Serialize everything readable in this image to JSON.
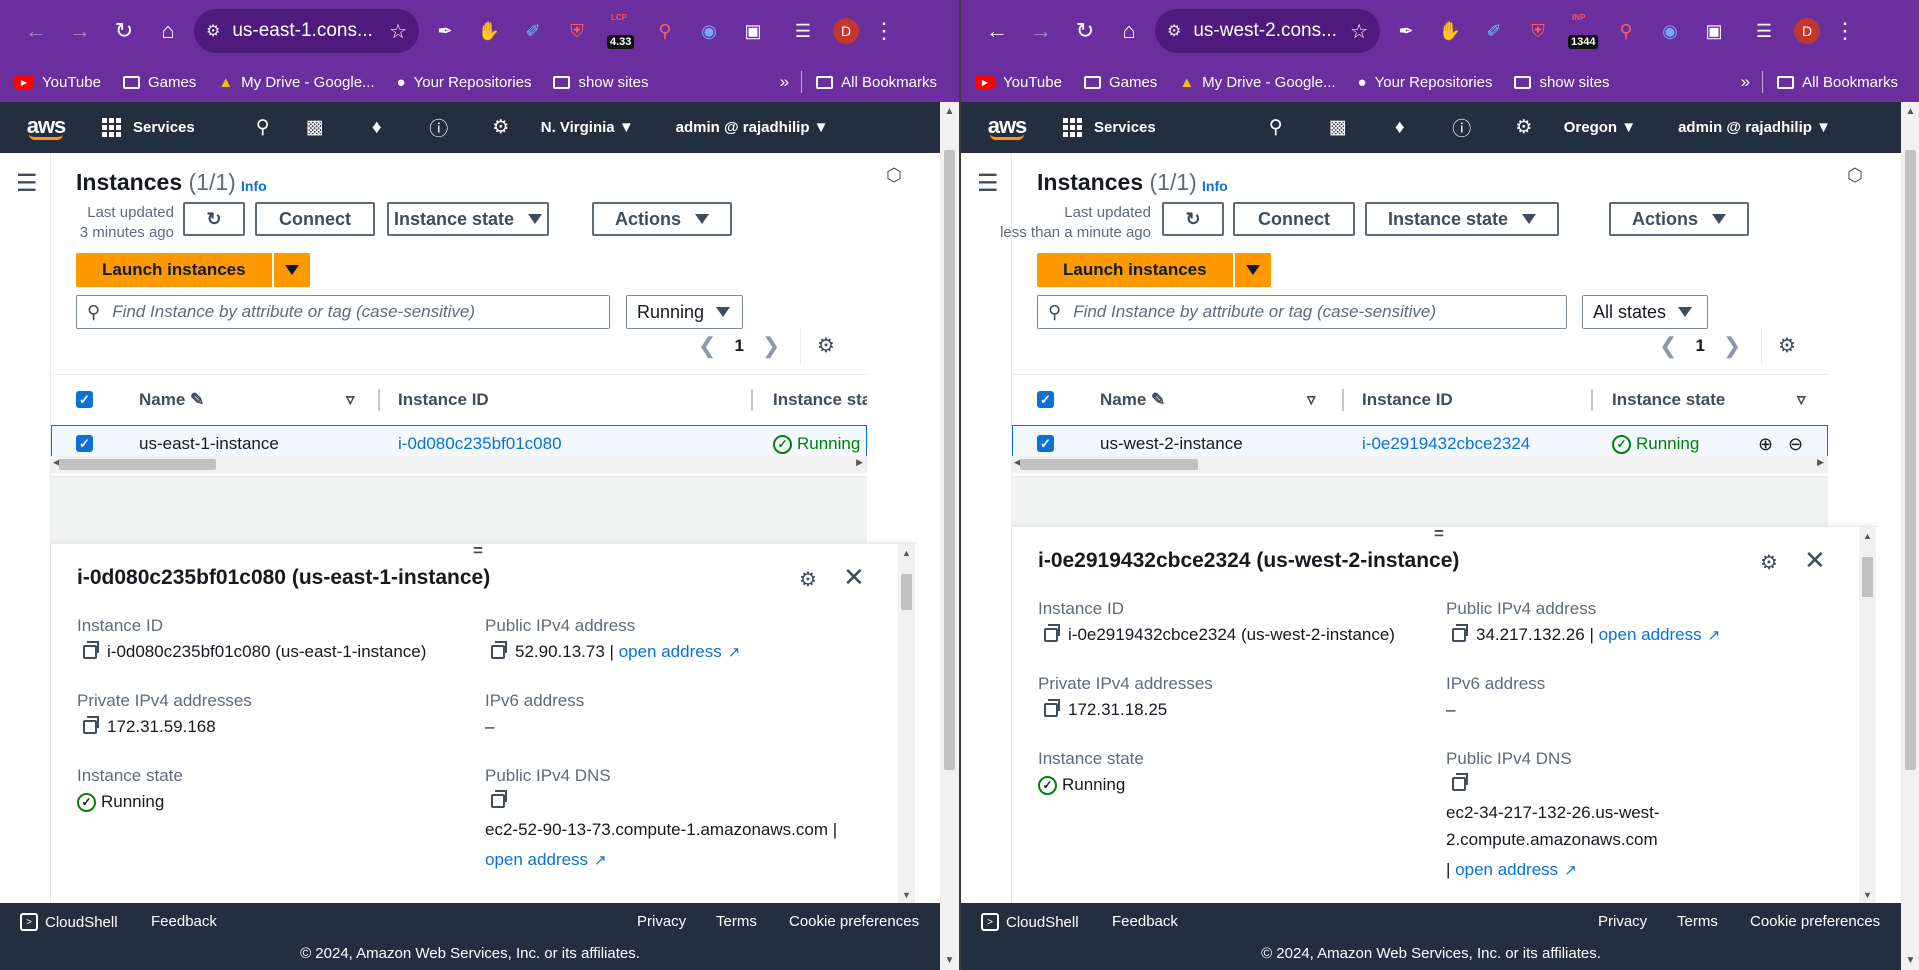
{
  "browser": {
    "bookmarks": [
      "YouTube",
      "Games",
      "My Drive - Google...",
      "Your Repositories",
      "show sites"
    ],
    "all_bookmarks": "All Bookmarks",
    "avatar_letter": "D"
  },
  "console": {
    "services_label": "Services",
    "account": "admin @ rajadhilip",
    "footer": {
      "cloudshell": "CloudShell",
      "feedback": "Feedback",
      "privacy": "Privacy",
      "terms": "Terms",
      "cookies": "Cookie preferences",
      "copyright": "© 2024, Amazon Web Services, Inc. or its affiliates."
    },
    "instances_title": "Instances",
    "info": "Info",
    "last_updated_label": "Last updated",
    "connect": "Connect",
    "instance_state_btn": "Instance state",
    "actions": "Actions",
    "launch": "Launch instances",
    "search_placeholder": "Find Instance by attribute or tag (case-sensitive)",
    "page_number": "1",
    "col_name": "Name",
    "col_instance_id": "Instance ID",
    "col_instance_state": "Instance state",
    "col_instance_state_trunc": "Instance sta",
    "detail_labels": {
      "instance_id": "Instance ID",
      "public_ipv4": "Public IPv4 address",
      "private_ipv4": "Private IPv4 addresses",
      "ipv6": "IPv6 address",
      "instance_state": "Instance state",
      "public_dns": "Public IPv4 DNS",
      "open_address": "open address"
    }
  },
  "left": {
    "url": "us-east-1.cons...",
    "ext_badge_top": "LCP",
    "ext_badge": "4.33",
    "region": "N. Virginia",
    "count": "(1/1)",
    "last_updated_value": "3 minutes ago",
    "filter_value": "Running",
    "row": {
      "name": "us-east-1-instance",
      "id": "i-0d080c235bf01c080",
      "state": "Running"
    },
    "detail": {
      "title": "i-0d080c235bf01c080 (us-east-1-instance)",
      "instance_id": "i-0d080c235bf01c080 (us-east-1-instance)",
      "public_ip": "52.90.13.73 |",
      "private_ip": "172.31.59.168",
      "ipv6": "–",
      "state": "Running",
      "dns": "ec2-52-90-13-73.compute-1.amazonaws.com |"
    }
  },
  "right": {
    "url": "us-west-2.cons...",
    "ext_badge_top": "INP",
    "ext_badge": "1344",
    "region": "Oregon",
    "count": "(1/1)",
    "last_updated_value": "less than a minute ago",
    "filter_value": "All states",
    "row": {
      "name": "us-west-2-instance",
      "id": "i-0e2919432cbce2324",
      "state": "Running"
    },
    "detail": {
      "title": "i-0e2919432cbce2324 (us-west-2-instance)",
      "instance_id": "i-0e2919432cbce2324 (us-west-2-instance)",
      "public_ip": "34.217.132.26 |",
      "private_ip": "172.31.18.25",
      "ipv6": "–",
      "state": "Running",
      "dns_line1": "ec2-34-217-132-26.us-west-",
      "dns_line2": "2.compute.amazonaws.com",
      "dns_prefix": "|"
    }
  },
  "colors": {
    "browser_chrome": "#6b2e9e",
    "aws_header": "#232f3e",
    "launch_orange": "#ff9900",
    "link_blue": "#0972d3",
    "running_green": "#037f0c"
  }
}
